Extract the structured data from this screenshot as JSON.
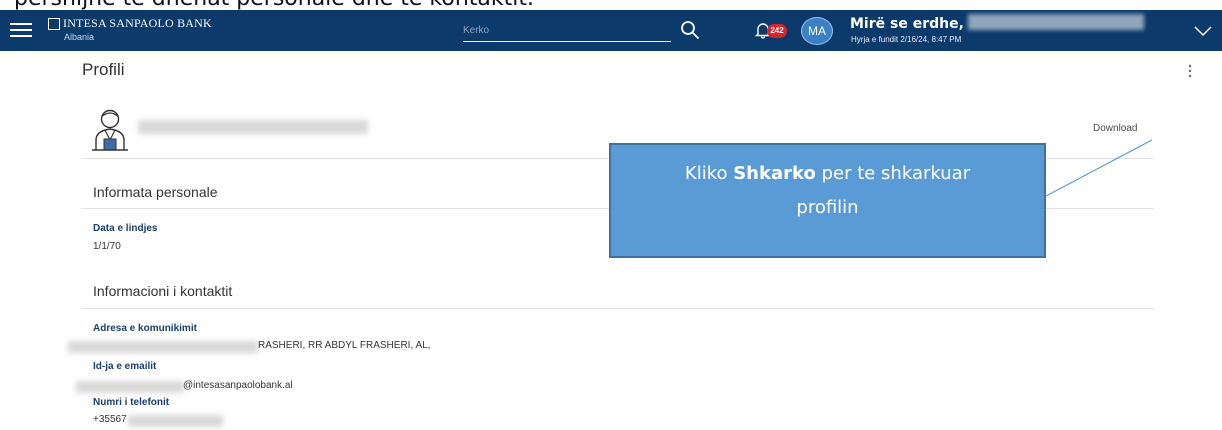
{
  "caption": "përshijnë të dhënat personale dhe të kontaktit.",
  "header": {
    "brand_name": "INTESA SANPAOLO BANK",
    "brand_sub": "Albania",
    "search_placeholder": "Kerko",
    "notification_count": "242",
    "avatar_initials": "MA",
    "welcome": "Mirë se erdhe,",
    "last_login": "Hyrja e fundit 2/16/24, 8:47 PM",
    "icons": [
      "menu-icon",
      "search-icon",
      "bell-icon",
      "chevron-down-icon"
    ],
    "colors": {
      "bar": "#0b3a6b",
      "badge": "#d8232a",
      "avatar": "#3b7fc4"
    }
  },
  "page": {
    "title": "Profili",
    "download_label": "Download"
  },
  "personal": {
    "section_title": "Informata personale",
    "birth_label": "Data e lindjes",
    "birth_value": "1/1/70"
  },
  "contact": {
    "section_title": "Informacioni i kontaktit",
    "address_label": "Adresa e komunikimit",
    "address_value": "RASHERI, RR ABDYL FRASHERI, AL,",
    "email_label": "Id-ja e emailit",
    "email_value": "@intesasanpaolobank.al",
    "phone_label": "Numri i telefonit",
    "phone_value": "+35567"
  },
  "callout": {
    "before": "Kliko ",
    "bold": "Shkarko",
    "after": " per te shkarkuar",
    "line2": "profilin",
    "colors": {
      "fill": "#5b9bd5",
      "border": "#41719c"
    }
  }
}
